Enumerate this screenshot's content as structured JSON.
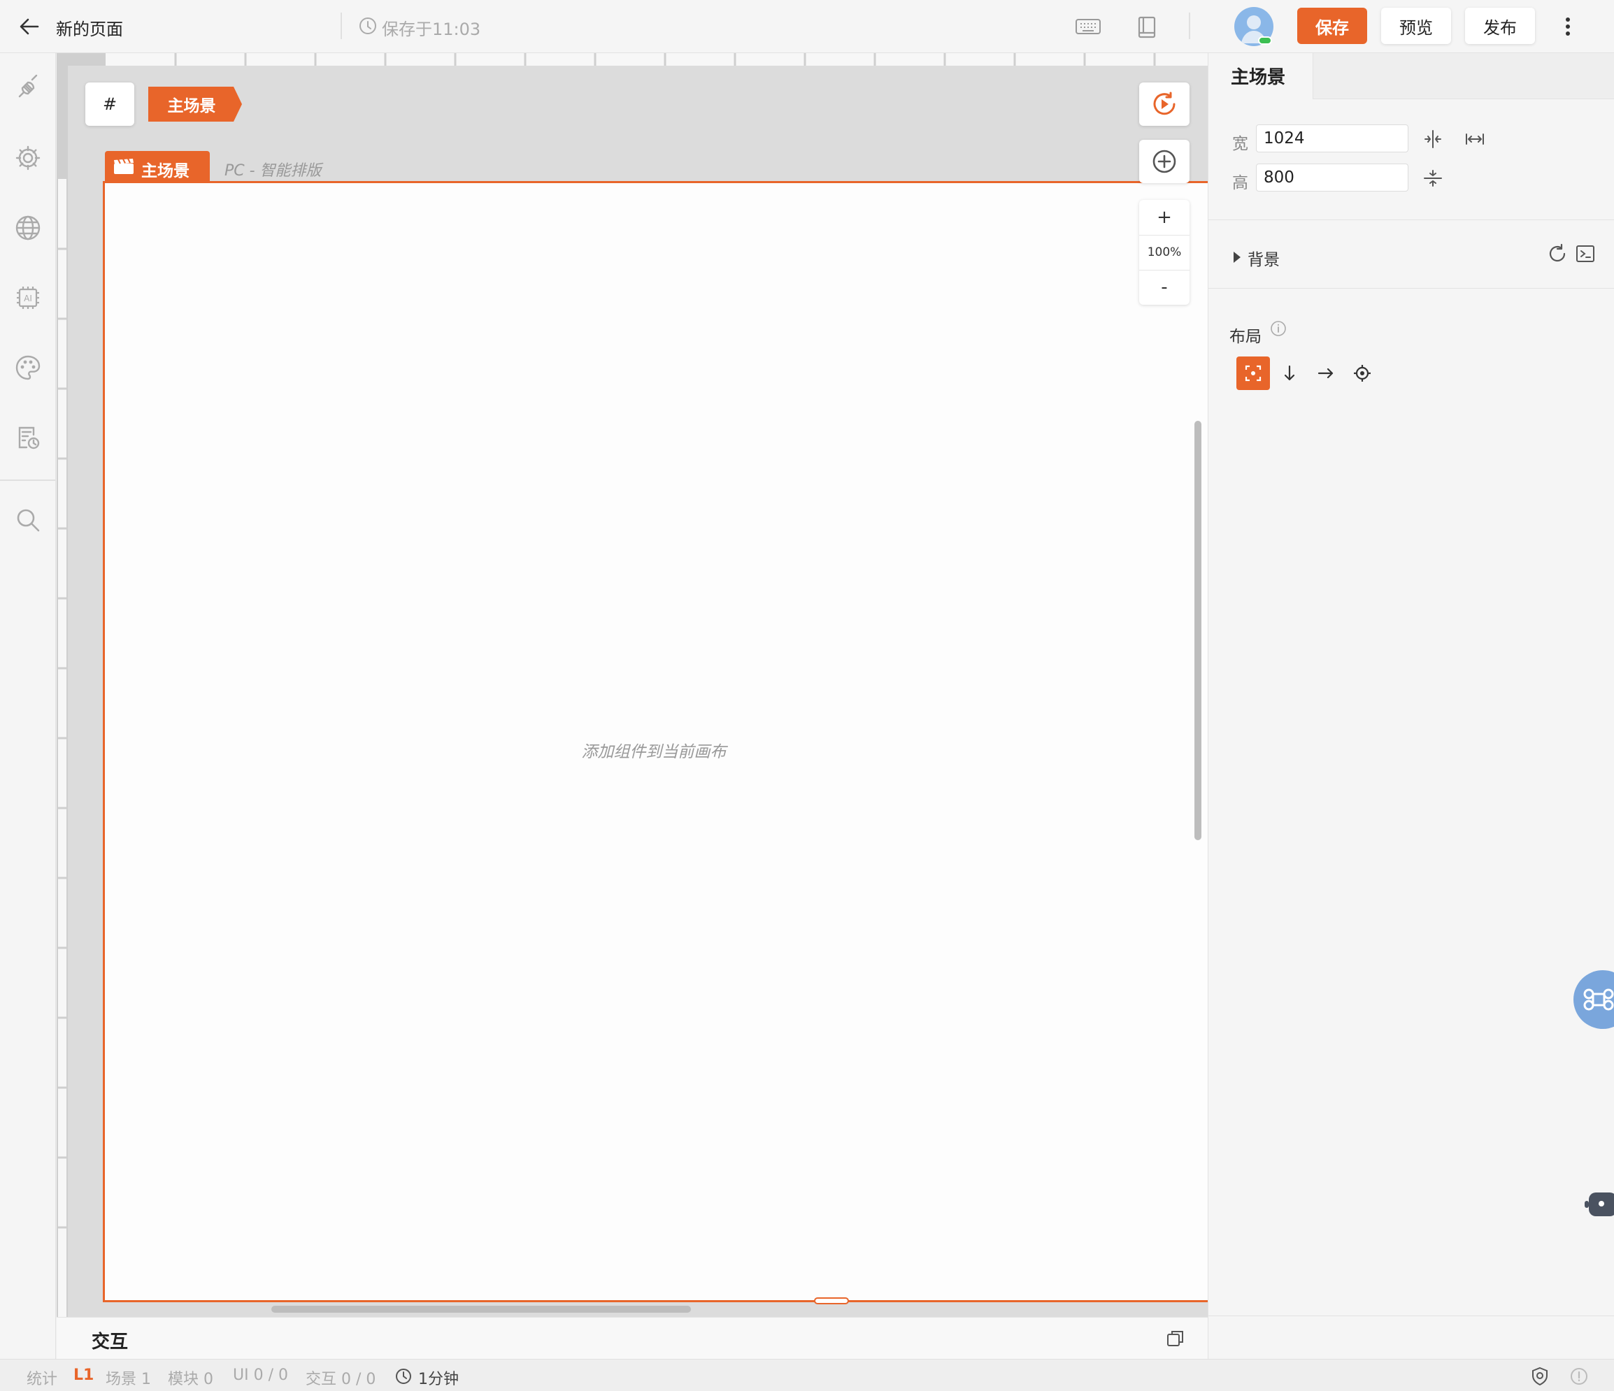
{
  "header": {
    "back_icon": "arrow-left-icon",
    "page_title": "新的页面",
    "save_status": "保存于11:03",
    "save_label": "保存",
    "preview_label": "预览",
    "publish_label": "发布"
  },
  "left_rail": {
    "items": [
      {
        "icon": "plugin-icon"
      },
      {
        "icon": "gear-icon"
      },
      {
        "icon": "globe-icon"
      },
      {
        "icon": "ai-chip-icon"
      },
      {
        "icon": "palette-icon"
      },
      {
        "icon": "document-clock-icon"
      },
      {
        "icon": "search-icon"
      }
    ]
  },
  "canvas": {
    "hash_label": "#",
    "scene_tab": "主场景",
    "artboard_tag": "主场景",
    "artboard_mode": "PC - 智能排版",
    "empty_hint": "添加组件到当前画布",
    "zoom_in": "+",
    "zoom_level": "100%",
    "zoom_out": "-"
  },
  "right_panel": {
    "tab_title": "主场景",
    "width_label": "宽",
    "width_value": "1024",
    "height_label": "高",
    "height_value": "800",
    "background_label": "背景",
    "layout_label": "布局",
    "accent_color": "#e8652a"
  },
  "bottom_panel": {
    "title": "交互"
  },
  "status_bar": {
    "stats_label": "统计",
    "level": "L1",
    "scenes": "场景 1",
    "modules": "模块 0",
    "ui": "UI 0 / 0",
    "interactions": "交互 0 / 0",
    "time": "1分钟"
  }
}
